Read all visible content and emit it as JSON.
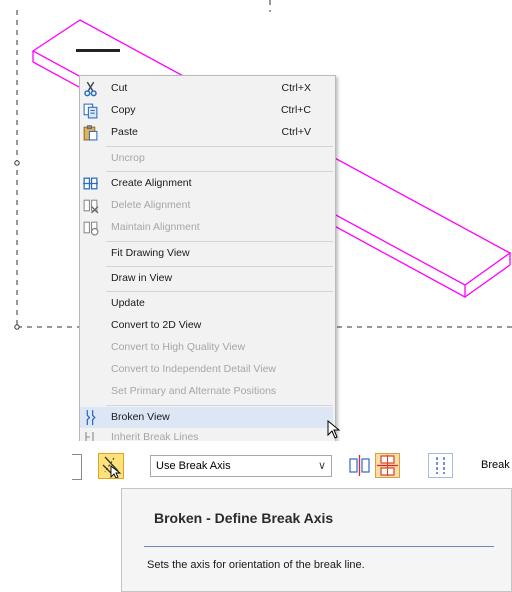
{
  "context_menu": {
    "items": [
      {
        "label": "Cut",
        "shortcut": "Ctrl+X",
        "icon": "scissors-icon",
        "enabled": true
      },
      {
        "label": "Copy",
        "shortcut": "Ctrl+C",
        "icon": "copy-icon",
        "enabled": true
      },
      {
        "label": "Paste",
        "shortcut": "Ctrl+V",
        "icon": "paste-icon",
        "enabled": true
      },
      {
        "label": "Uncrop",
        "enabled": false
      },
      {
        "label": "Create Alignment",
        "icon": "create-alignment-icon",
        "enabled": true
      },
      {
        "label": "Delete Alignment",
        "icon": "delete-alignment-icon",
        "enabled": false
      },
      {
        "label": "Maintain Alignment",
        "icon": "maintain-alignment-icon",
        "enabled": false
      },
      {
        "label": "Fit Drawing View",
        "enabled": true
      },
      {
        "label": "Draw in View",
        "enabled": true
      },
      {
        "label": "Update",
        "enabled": true
      },
      {
        "label": "Convert to 2D View",
        "enabled": true
      },
      {
        "label": "Convert to High Quality View",
        "enabled": false
      },
      {
        "label": "Convert to Independent Detail View",
        "enabled": false
      },
      {
        "label": "Set Primary and Alternate Positions",
        "enabled": false
      },
      {
        "label": "Broken View",
        "icon": "broken-view-icon",
        "enabled": true,
        "highlighted": true
      },
      {
        "label": "Inherit Break Lines",
        "icon": "inherit-break-lines-icon",
        "enabled": false
      }
    ]
  },
  "toolbar": {
    "break_axis_select": {
      "value": "Use Break Axis"
    },
    "trailing_label": "Break"
  },
  "tooltip": {
    "title": "Broken - Define Break Axis",
    "description": "Sets the axis for orientation of the break line."
  },
  "colors": {
    "part_edges": "#ff00ff",
    "menu_highlight": "#dce6f5",
    "active_button": "#fde27a",
    "tooltip_rule": "#6c87c9"
  }
}
